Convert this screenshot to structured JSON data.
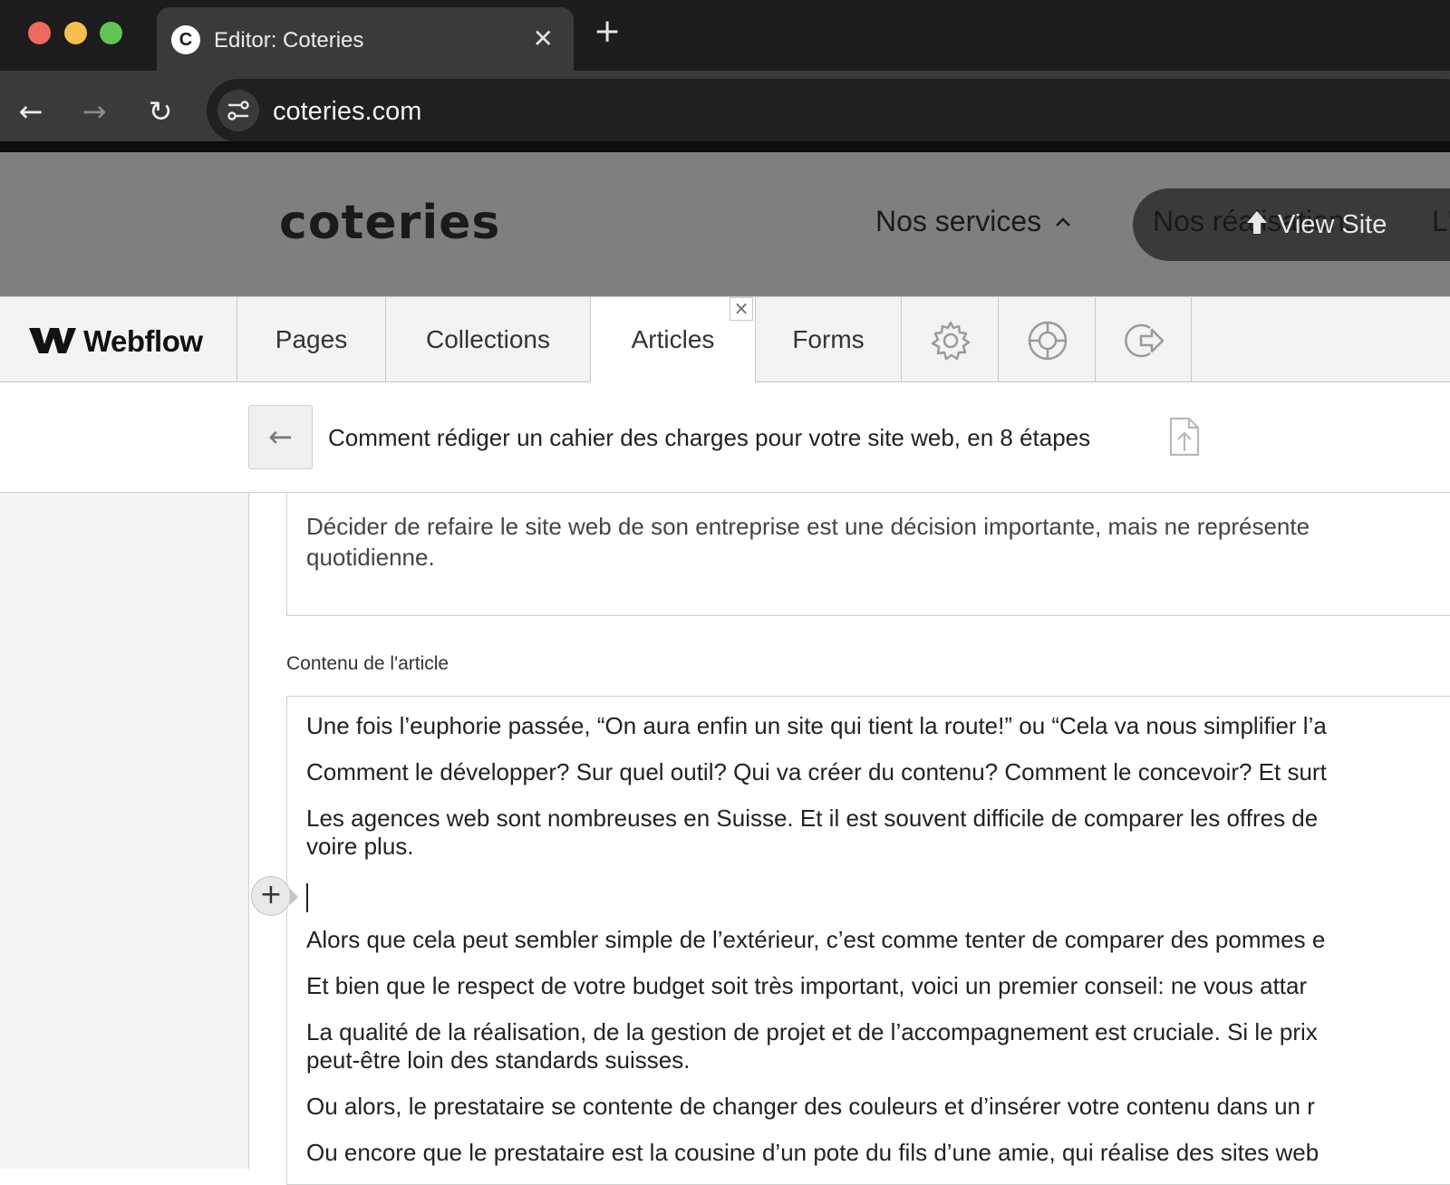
{
  "browser": {
    "tab_favicon": "C",
    "tab_title": "Editor: Coteries",
    "tab_close": "✕",
    "new_tab": "+",
    "url": "coteries.com",
    "back": "←",
    "forward": "→",
    "reload": "↻"
  },
  "site": {
    "logo": "coteries",
    "nav_services": "Nos services",
    "nav_services_chevron": "^",
    "nav_realisations_partial": "Nos réalisations",
    "view_site": "View Site",
    "nav_trailing_partial": "L'"
  },
  "webflow": {
    "logo_text": "Webflow",
    "tabs": [
      "Pages",
      "Collections",
      "Articles",
      "Forms"
    ],
    "active_tab": "Articles",
    "active_tab_close": "×",
    "icon_tabs": [
      "gear-icon",
      "lifebuoy-icon",
      "logout-icon"
    ]
  },
  "item": {
    "back_label": "←",
    "title": "Comment rédiger un cahier des charges pour votre site web, en 8 étapes"
  },
  "summary": {
    "lines": [
      "Décider de refaire le site web de son entreprise est une décision importante, mais ne représente",
      "quotidienne."
    ]
  },
  "content": {
    "label": "Contenu de l'article",
    "add_button": "+",
    "paragraphs": [
      "Une fois l’euphorie passée, “On aura enfin un site qui tient la route!” ou “Cela va nous simplifier l’a",
      "Comment le développer? Sur quel outil? Qui va créer du contenu? Comment le concevoir? Et surt",
      "Les agences web sont nombreuses en Suisse. Et il est souvent difficile de comparer les offres de",
      "voire plus.",
      "Alors que cela peut sembler simple de l’extérieur, c’est comme tenter de comparer des pommes e",
      "Et bien que le respect de votre budget soit très important, voici un premier conseil: ne vous attar",
      "La qualité de la réalisation, de la gestion de projet et de l’accompagnement est cruciale. Si le prix",
      "peut-être loin des standards suisses.",
      "Ou alors, le prestataire se contente de changer des couleurs et d’insérer votre contenu dans un r",
      "Ou encore que le prestataire est la cousine d’un pote du fils d’une amie, qui réalise des sites web"
    ]
  },
  "colors": {
    "chrome_dark": "#1c1c1c",
    "chrome_toolbar": "#3a3a3a",
    "site_overlay": "#7f7f7f",
    "webflow_bar": "#f3f3f3"
  }
}
